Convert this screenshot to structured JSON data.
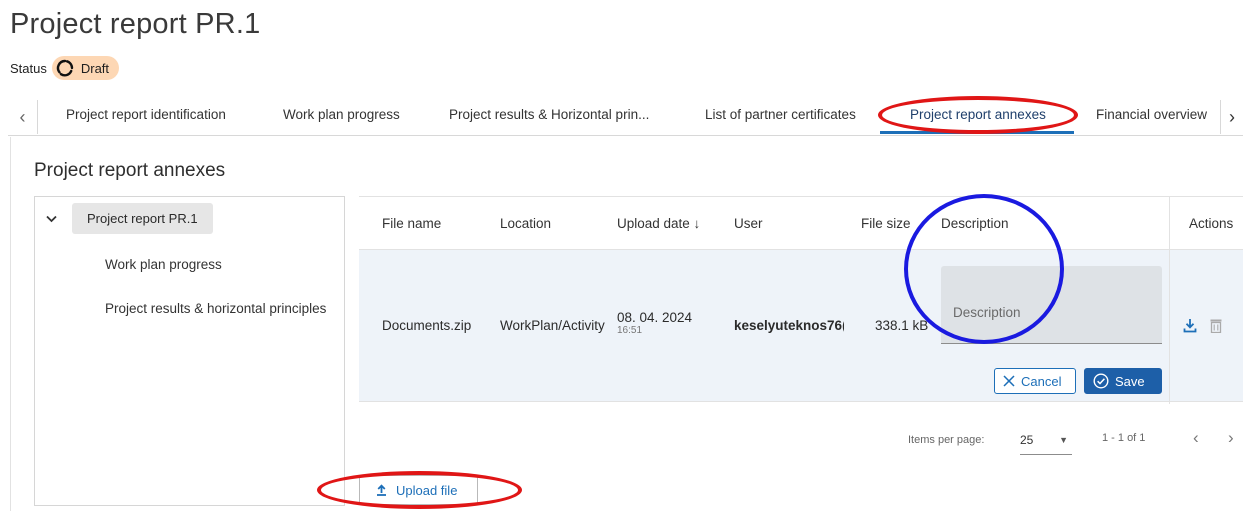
{
  "page": {
    "title": "Project report PR.1",
    "status_label": "Status",
    "status_value": "Draft"
  },
  "tabs": {
    "items": [
      "Project report identification",
      "Work plan progress",
      "Project results & Horizontal prin...",
      "List of partner certificates",
      "Project report annexes",
      "Financial overview"
    ],
    "active": "Project report annexes",
    "prev_icon": "chevron-left-icon",
    "next_icon": "chevron-right-icon"
  },
  "section": {
    "title": "Project report annexes"
  },
  "tree": {
    "root": "Project report PR.1",
    "children": [
      "Work plan progress",
      "Project results & horizontal principles"
    ]
  },
  "grid": {
    "columns": {
      "file_name": "File name",
      "location": "Location",
      "upload_date": "Upload date ↓",
      "user": "User",
      "file_size": "File size",
      "description": "Description",
      "actions": "Actions"
    },
    "rows": [
      {
        "file_name": "Documents.zip",
        "location": "WorkPlan/Activity",
        "upload_date": "08. 04. 2024",
        "upload_time": "16:51",
        "user": "keselyuteknos76(",
        "file_size": "338.1 kB",
        "description_placeholder": "Description",
        "description_value": ""
      }
    ],
    "cancel_label": "Cancel",
    "save_label": "Save"
  },
  "paginator": {
    "items_per_page_label": "Items per page:",
    "page_size": "25",
    "range": "1 - 1 of 1"
  },
  "upload": {
    "label": "Upload file"
  },
  "colors": {
    "accent": "#1d6fb8",
    "save_bg": "#1d5fa8",
    "status_badge": "#fdd7b4",
    "row_highlight": "#eef3f9",
    "annotation_red": "#e01616",
    "annotation_blue": "#1a1ae0"
  }
}
